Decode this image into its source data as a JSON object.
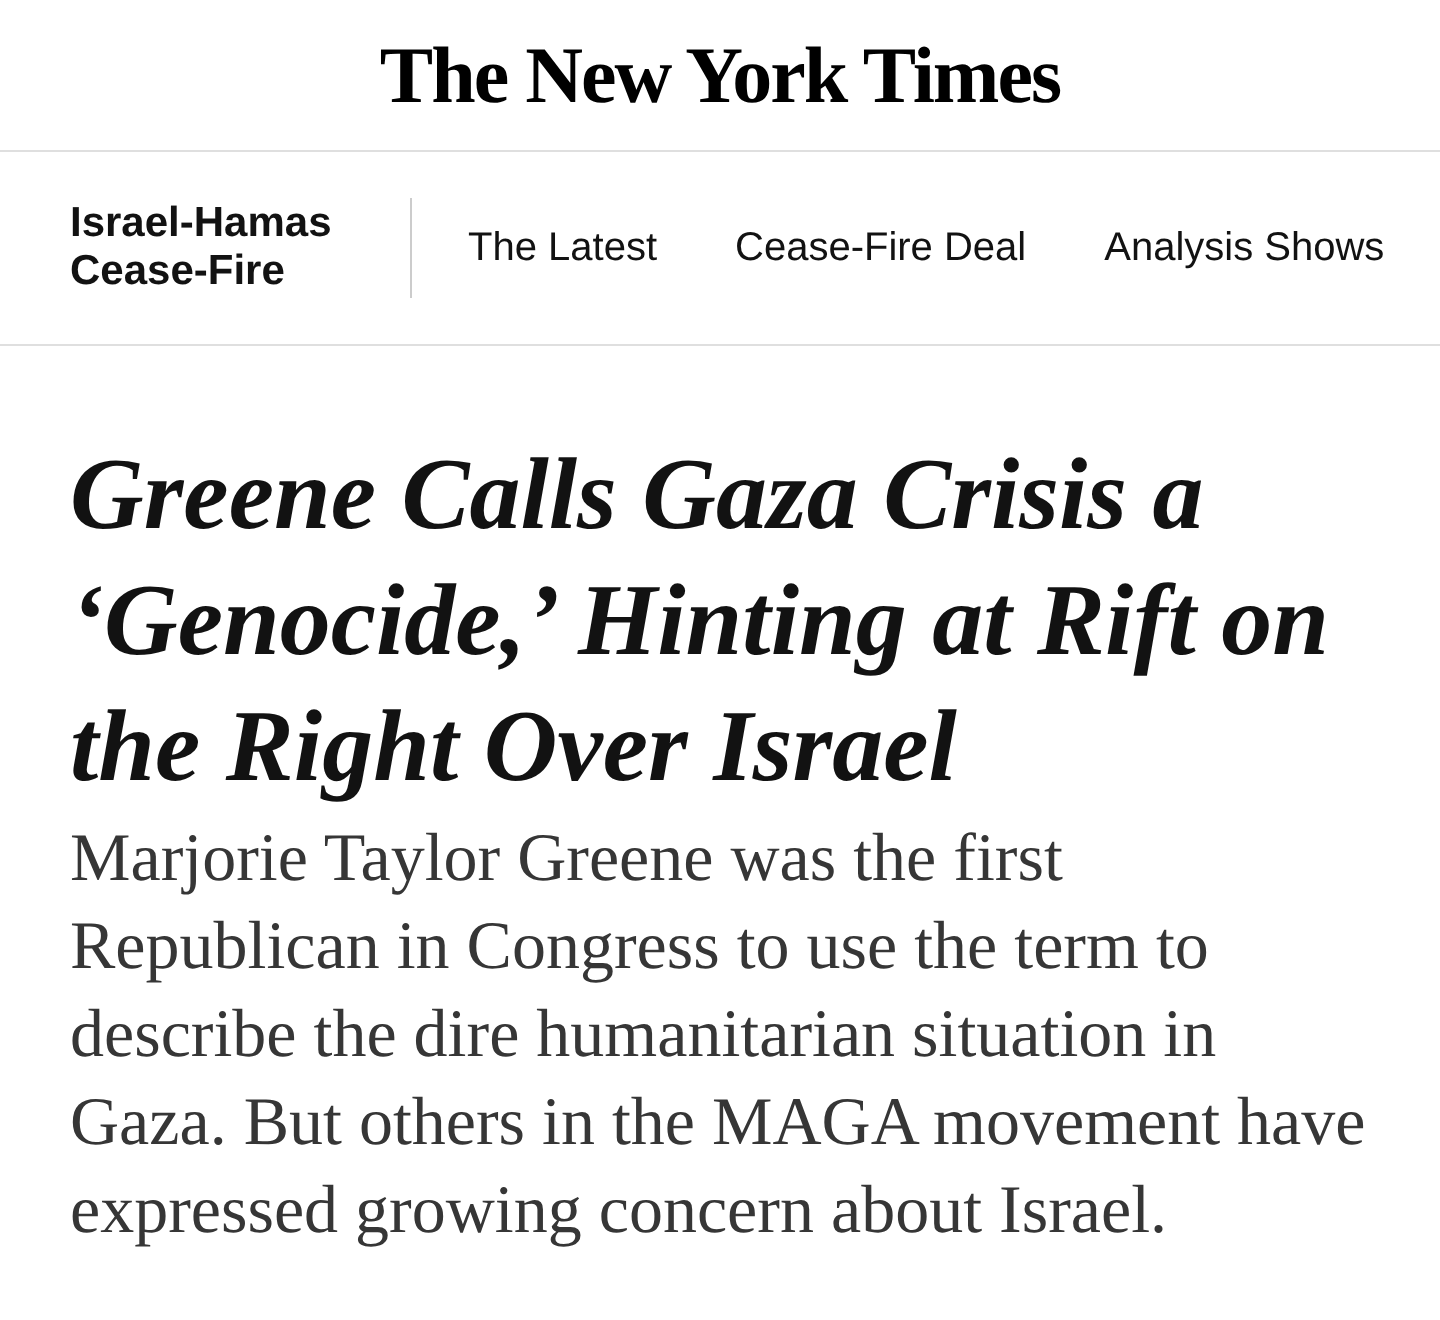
{
  "masthead": {
    "logo": "The New York Times"
  },
  "section_nav": {
    "title": "Israel-Hamas Cease-Fire",
    "items": [
      {
        "label": "The Latest"
      },
      {
        "label": "Cease-Fire Deal"
      },
      {
        "label": "Analysis Shows"
      }
    ]
  },
  "article": {
    "headline": "Greene Calls Gaza Crisis a ‘Genocide,’ Hinting at Rift on the Right Over Israel",
    "summary": "Marjorie Taylor Greene was the first Republican in Congress to use the term to describe the dire humanitarian situation in Gaza. But others in the MAGA movement have expressed growing concern about Israel."
  }
}
